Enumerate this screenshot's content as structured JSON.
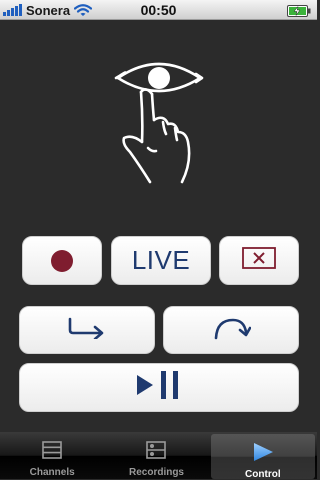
{
  "status_bar": {
    "carrier": "Sonera",
    "time": "00:50",
    "signal_icon": "signal-bars-icon",
    "wifi_icon": "wifi-icon",
    "battery_icon": "battery-charging-icon"
  },
  "logo": {
    "icon": "eye-finger-logo"
  },
  "controls": {
    "record": {
      "icon": "record-icon"
    },
    "live_label": "LIVE",
    "stop": {
      "icon": "stop-x-icon"
    },
    "skip_back": {
      "icon": "skip-back-icon"
    },
    "skip_forward": {
      "icon": "skip-forward-icon"
    },
    "play_pause": {
      "icon": "play-pause-icon"
    }
  },
  "colors": {
    "record": "#7f1d2f",
    "accent_blue": "#1f3a6f",
    "background": "#2b2b2b"
  },
  "tabs": [
    {
      "label": "Channels",
      "icon": "channels-icon",
      "selected": false
    },
    {
      "label": "Recordings",
      "icon": "recordings-icon",
      "selected": false
    },
    {
      "label": "Control",
      "icon": "control-play-icon",
      "selected": true
    }
  ]
}
